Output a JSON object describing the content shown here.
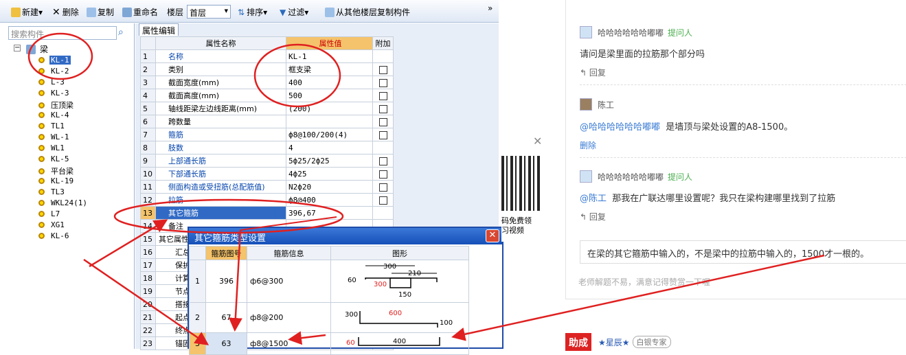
{
  "toolbar": {
    "new": "新建",
    "delete": "删除",
    "copy": "复制",
    "rename": "重命名",
    "floor_label": "楼层",
    "floor_value": "首层",
    "sort": "排序",
    "filter": "过滤",
    "copy_from_floor": "从其他楼层复制构件",
    "overflow": "»"
  },
  "tree": {
    "search_placeholder": "搜索构件",
    "root": "梁",
    "items": [
      "KL-1",
      "KL-2",
      "L-3",
      "KL-3",
      "压顶梁",
      "KL-4",
      "TL1",
      "WL-1",
      "WL1",
      "KL-5",
      "平台梁",
      "KL-19",
      "TL3",
      "WKL24(1)",
      "L7",
      "XG1",
      "KL-6"
    ]
  },
  "props": {
    "tab": "属性编辑",
    "headers": {
      "name": "属性名称",
      "value": "属性值",
      "extra": "附加"
    },
    "rows": [
      {
        "n": "1",
        "name": "名称",
        "value": "KL-1",
        "link": true,
        "cb": false
      },
      {
        "n": "2",
        "name": "类别",
        "value": "框支梁",
        "link": false,
        "cb": true
      },
      {
        "n": "3",
        "name": "截面宽度(mm)",
        "value": "400",
        "link": false,
        "cb": true
      },
      {
        "n": "4",
        "name": "截面高度(mm)",
        "value": "500",
        "link": false,
        "cb": true
      },
      {
        "n": "5",
        "name": "轴线距梁左边线距离(mm)",
        "value": "(200)",
        "link": false,
        "cb": true
      },
      {
        "n": "6",
        "name": "跨数量",
        "value": "",
        "link": false,
        "cb": true
      },
      {
        "n": "7",
        "name": "箍筋",
        "value": "ф8@100/200(4)",
        "link": true,
        "cb": true
      },
      {
        "n": "8",
        "name": "肢数",
        "value": "4",
        "link": true,
        "cb": false
      },
      {
        "n": "9",
        "name": "上部通长筋",
        "value": "5ф25/2ф25",
        "link": true,
        "cb": true
      },
      {
        "n": "10",
        "name": "下部通长筋",
        "value": "4ф25",
        "link": true,
        "cb": true
      },
      {
        "n": "11",
        "name": "侧面构造或受扭筋(总配筋值)",
        "value": "N2ф20",
        "link": true,
        "cb": true
      },
      {
        "n": "12",
        "name": "拉筋",
        "value": "ф8@400",
        "link": true,
        "cb": true
      },
      {
        "n": "13",
        "name": "其它箍筋",
        "value": "396,67",
        "link": false,
        "cb": false
      },
      {
        "n": "14",
        "name": "备注",
        "value": "",
        "link": false,
        "cb": false
      },
      {
        "n": "15",
        "name": "其它属性",
        "value": "",
        "link": false,
        "cb": false
      },
      {
        "n": "16",
        "name": "汇总信息",
        "value": "",
        "link": false,
        "cb": false
      },
      {
        "n": "17",
        "name": "保护层厚度",
        "value": "",
        "link": false,
        "cb": false
      },
      {
        "n": "18",
        "name": "计算设置",
        "value": "",
        "link": false,
        "cb": false
      },
      {
        "n": "19",
        "name": "节点设置",
        "value": "",
        "link": false,
        "cb": false
      },
      {
        "n": "20",
        "name": "搭接设置",
        "value": "",
        "link": false,
        "cb": false
      },
      {
        "n": "21",
        "name": "起点顶标高",
        "value": "",
        "link": false,
        "cb": false
      },
      {
        "n": "22",
        "name": "终点顶标高",
        "value": "",
        "link": false,
        "cb": false
      },
      {
        "n": "23",
        "name": "锚固搭接",
        "value": "",
        "link": false,
        "cb": false
      }
    ]
  },
  "dialog": {
    "title": "其它箍筋类型设置",
    "close": "✕",
    "headers": {
      "code": "箍筋图号",
      "info": "箍筋信息",
      "shape": "图形"
    },
    "rows": [
      {
        "n": "1",
        "code": "396",
        "info": "ф6@300",
        "dims": [
          "300",
          "210",
          "60",
          "300",
          "150"
        ]
      },
      {
        "n": "2",
        "code": "67",
        "info": "ф8@200",
        "dims": [
          "300",
          "600",
          "100"
        ]
      },
      {
        "n": "3",
        "code": "63",
        "info": "ф8@1500",
        "dims": [
          "60",
          "400"
        ]
      }
    ]
  },
  "qr": {
    "line1": "码免费领",
    "line2": "习视频"
  },
  "comments": [
    {
      "user": "哈哈哈哈哈哈嘟嘟",
      "tag": "提问人",
      "text": "请问是梁里面的拉筋那个部分吗",
      "action": "回复"
    },
    {
      "user": "陈工",
      "tag": "",
      "mention": "@哈哈哈哈哈哈嘟嘟",
      "text": "是墙顶与梁处设置的A8-1500。",
      "action": "删除"
    },
    {
      "user": "哈哈哈哈哈哈嘟嘟",
      "tag": "提问人",
      "mention": "@陈工",
      "text": "那我在广联达哪里设置呢？我只在梁构建哪里找到了拉筋",
      "action": "回复"
    }
  ],
  "answer": "在梁的其它箍筋中输入的，不是梁中的拉筋中输入的，1500才一根的。",
  "hint": "老师解题不易，满意记得赞赏一下喔",
  "bottom": {
    "logo": "助成",
    "user": "★星辰★",
    "badge": "白银专家"
  },
  "colors": {
    "annotation": "#e02020",
    "selection": "#316ac5"
  }
}
